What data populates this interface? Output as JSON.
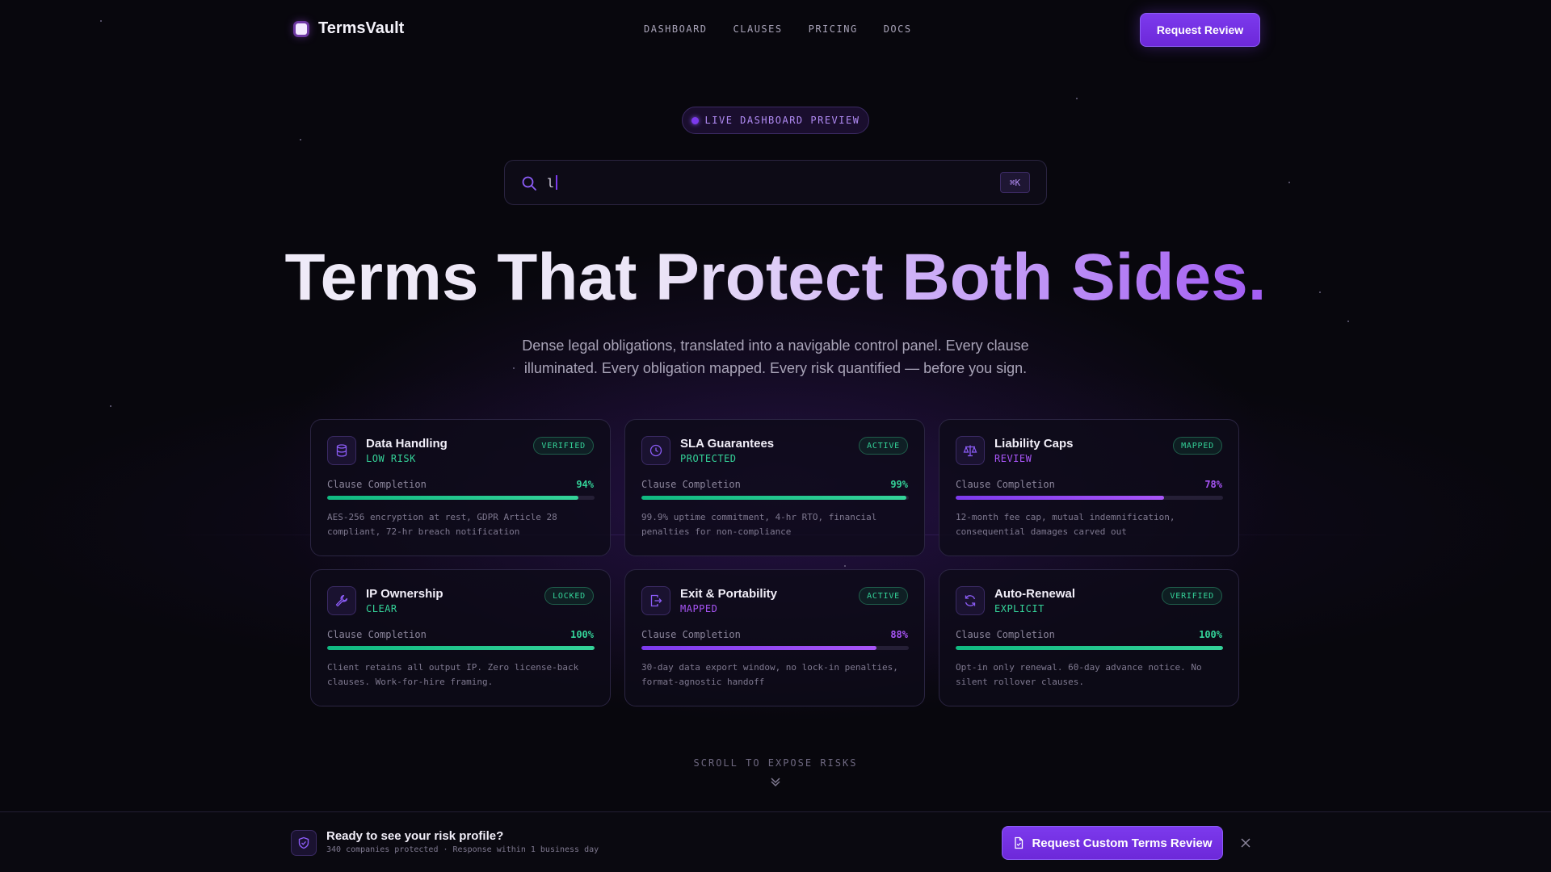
{
  "brand": {
    "name": "TermsVault"
  },
  "nav": {
    "links": [
      "DASHBOARD",
      "CLAUSES",
      "PRICING",
      "DOCS"
    ],
    "cta": "Request Review"
  },
  "pill": {
    "label": "LIVE DASHBOARD PREVIEW"
  },
  "search": {
    "value": "l",
    "shortcut": "⌘K"
  },
  "hero": {
    "title": "Terms That Protect Both Sides.",
    "subtitle": "Dense legal obligations, translated into a navigable control panel. Every clause illuminated. Every obligation mapped. Every risk quantified — before you sign."
  },
  "cards": [
    {
      "title": "Data Handling",
      "status": "LOW RISK",
      "badge": "VERIFIED",
      "label": "Clause Completion",
      "pct_text": "94%",
      "progress": 0.94,
      "tone": "green",
      "icon": "database-icon",
      "desc": "AES-256 encryption at rest, GDPR Article 28 compliant, 72-hr breach notification"
    },
    {
      "title": "SLA Guarantees",
      "status": "PROTECTED",
      "badge": "ACTIVE",
      "label": "Clause Completion",
      "pct_text": "99%",
      "progress": 0.99,
      "tone": "green",
      "icon": "clock-icon",
      "desc": "99.9% uptime commitment, 4-hr RTO, financial penalties for non-compliance"
    },
    {
      "title": "Liability Caps",
      "status": "REVIEW",
      "badge": "MAPPED",
      "label": "Clause Completion",
      "pct_text": "78%",
      "progress": 0.78,
      "tone": "purple",
      "icon": "scale-icon",
      "desc": "12-month fee cap, mutual indemnification, consequential damages carved out"
    },
    {
      "title": "IP Ownership",
      "status": "CLEAR",
      "badge": "LOCKED",
      "label": "Clause Completion",
      "pct_text": "100%",
      "progress": 1.0,
      "tone": "green",
      "icon": "wrench-icon",
      "desc": "Client retains all output IP. Zero license-back clauses. Work-for-hire framing."
    },
    {
      "title": "Exit & Portability",
      "status": "MAPPED",
      "badge": "ACTIVE",
      "label": "Clause Completion",
      "pct_text": "88%",
      "progress": 0.88,
      "tone": "purple",
      "icon": "export-icon",
      "desc": "30-day data export window, no lock-in penalties, format-agnostic handoff"
    },
    {
      "title": "Auto-Renewal",
      "status": "EXPLICIT",
      "badge": "VERIFIED",
      "label": "Clause Completion",
      "pct_text": "100%",
      "progress": 1.0,
      "tone": "green",
      "icon": "refresh-icon",
      "desc": "Opt-in only renewal. 60-day advance notice. No silent rollover clauses."
    }
  ],
  "scroll": {
    "label": "SCROLL TO EXPOSE RISKS"
  },
  "bottom_bar": {
    "title": "Ready to see your risk profile?",
    "subtitle": "340 companies protected · Response within 1 business day",
    "cta": "Request Custom Terms Review"
  },
  "colors": {
    "accent": "#7c3aed",
    "green": "#34d399",
    "purple": "#a855f7",
    "background": "#08070d"
  }
}
